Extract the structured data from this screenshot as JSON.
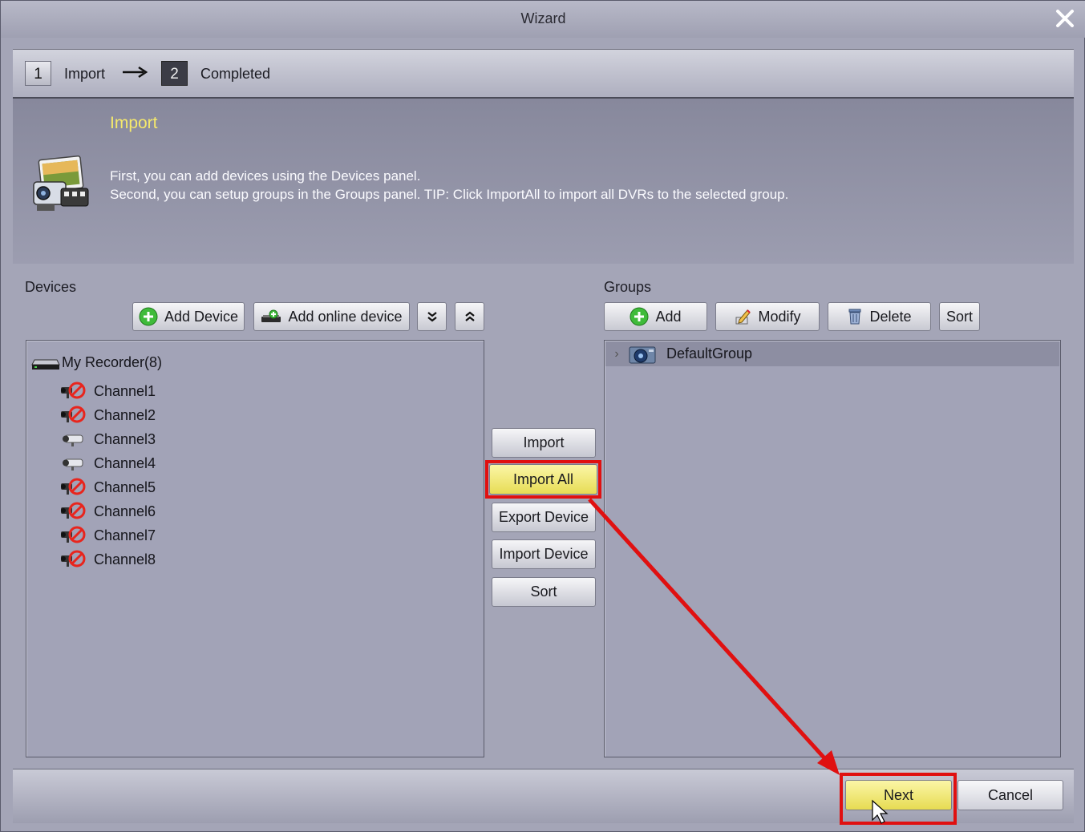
{
  "window": {
    "title": "Wizard"
  },
  "steps": [
    {
      "number": "1",
      "label": "Import"
    },
    {
      "number": "2",
      "label": "Completed"
    }
  ],
  "intro": {
    "heading": "Import",
    "line1": "First, you can add devices using the Devices panel.",
    "line2": "Second, you can setup groups in the Groups panel. TIP: Click ImportAll to import all DVRs to the selected group."
  },
  "devices": {
    "label": "Devices",
    "toolbar": {
      "add_device": "Add Device",
      "add_online_device": "Add online device"
    },
    "tree": {
      "root": "My Recorder(8)",
      "channels": [
        {
          "name": "Channel1",
          "status": "offline"
        },
        {
          "name": "Channel2",
          "status": "offline"
        },
        {
          "name": "Channel3",
          "status": "online"
        },
        {
          "name": "Channel4",
          "status": "online"
        },
        {
          "name": "Channel5",
          "status": "offline"
        },
        {
          "name": "Channel6",
          "status": "offline"
        },
        {
          "name": "Channel7",
          "status": "offline"
        },
        {
          "name": "Channel8",
          "status": "offline"
        }
      ]
    }
  },
  "middle_buttons": {
    "import": "Import",
    "import_all": "Import All",
    "export_device": "Export Device",
    "import_device": "Import Device",
    "sort": "Sort"
  },
  "groups": {
    "label": "Groups",
    "toolbar": {
      "add": "Add",
      "modify": "Modify",
      "delete": "Delete",
      "sort": "Sort"
    },
    "items": [
      "DefaultGroup"
    ]
  },
  "footer": {
    "next": "Next",
    "cancel": "Cancel"
  },
  "colors": {
    "highlight": "#e01010",
    "accent_yellow": "#f5e96c",
    "offline_red": "#e8251d"
  }
}
